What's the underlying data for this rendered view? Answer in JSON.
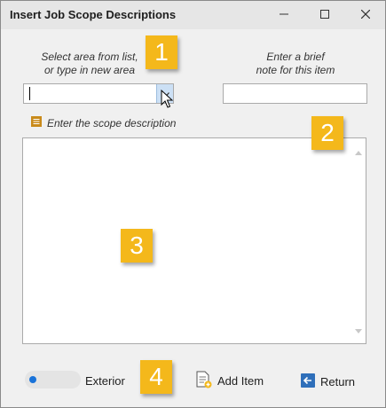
{
  "window": {
    "title": "Insert Job Scope Descriptions"
  },
  "form": {
    "area_label_line1": "Select area from list,",
    "area_label_line2": "or type in new area",
    "area_value": "",
    "note_label_line1": "Enter a brief",
    "note_label_line2": "note for this item",
    "note_value": "",
    "scope_label": "Enter the scope description",
    "scope_value": ""
  },
  "badges": [
    "1",
    "2",
    "3",
    "4"
  ],
  "footer": {
    "toggle_label": "Exterior",
    "add_label": "Add Item",
    "return_label": "Return"
  },
  "colors": {
    "badge": "#f4b81b",
    "toggle_knob": "#1a73d9",
    "return_icon": "#2f6fba",
    "scope_icon": "#c98a1a"
  },
  "icons": {
    "minimize": "minimize-icon",
    "maximize": "maximize-icon",
    "close": "close-icon",
    "dropdown": "chevron-down-icon",
    "scope": "document-lines-icon",
    "add": "add-document-icon",
    "return": "arrow-left-icon"
  }
}
